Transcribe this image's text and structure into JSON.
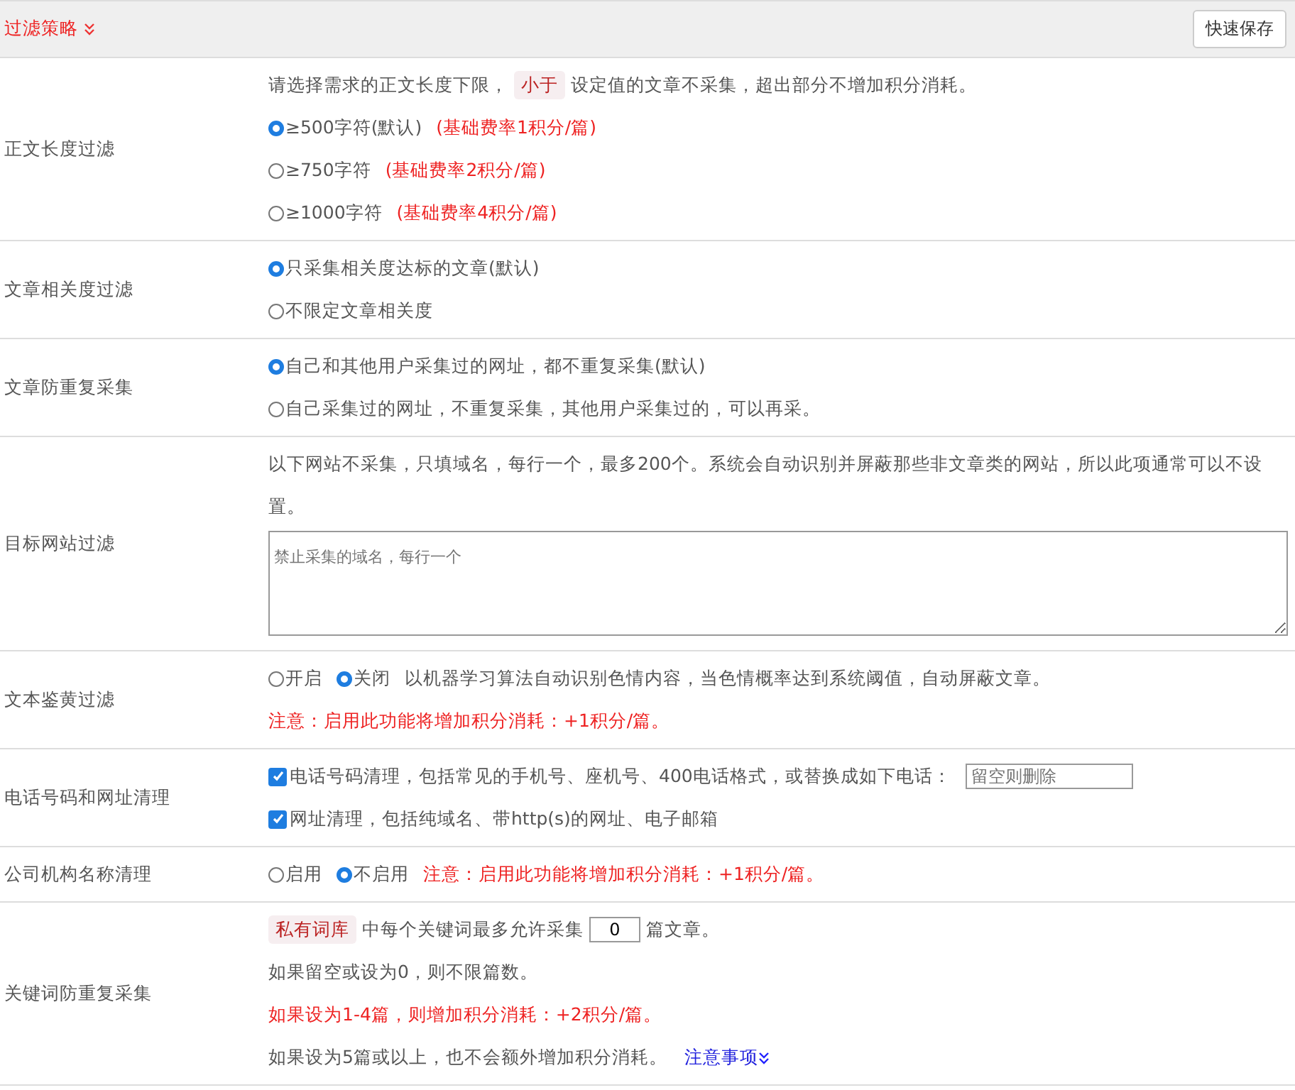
{
  "header": {
    "title": "过滤策略",
    "save_button": "快速保存"
  },
  "sections": [
    {
      "label": "正文长度过滤",
      "lines": [
        [
          {
            "kind": "text",
            "text": "请选择需求的正文长度下限，"
          },
          {
            "kind": "tag",
            "text": "小于"
          },
          {
            "kind": "text",
            "text": "设定值的文章不采集，超出部分不增加积分消耗。"
          }
        ],
        [
          {
            "kind": "radio",
            "text": "≥500字符(默认)",
            "selected": true
          },
          {
            "kind": "note",
            "text": "(基础费率1积分/篇)"
          }
        ],
        [
          {
            "kind": "radio",
            "text": "≥750字符",
            "selected": false
          },
          {
            "kind": "note",
            "text": "(基础费率2积分/篇)"
          }
        ],
        [
          {
            "kind": "radio",
            "text": "≥1000字符",
            "selected": false
          },
          {
            "kind": "note",
            "text": "(基础费率4积分/篇)"
          }
        ]
      ]
    },
    {
      "label": "文章相关度过滤",
      "lines": [
        [
          {
            "kind": "radio",
            "text": "只采集相关度达标的文章(默认)",
            "selected": true
          }
        ],
        [
          {
            "kind": "radio",
            "text": "不限定文章相关度",
            "selected": false
          }
        ]
      ]
    },
    {
      "label": "文章防重复采集",
      "lines": [
        [
          {
            "kind": "radio",
            "text": "自己和其他用户采集过的网址，都不重复采集(默认)",
            "selected": true
          }
        ],
        [
          {
            "kind": "radio",
            "text": "自己采集过的网址，不重复采集，其他用户采集过的，可以再采。",
            "selected": false
          }
        ]
      ]
    },
    {
      "label": "目标网站过滤",
      "lines": [
        [
          {
            "kind": "text",
            "text": "以下网站不采集，只填域名，每行一个，最多200个。系统会自动识别并屏蔽那些非文章类的网站，所以此项通常可以不设置。"
          }
        ],
        [
          {
            "kind": "textarea",
            "placeholder": "禁止采集的域名，每行一个"
          }
        ]
      ]
    },
    {
      "label": "文本鉴黄过滤",
      "lines": [
        [
          {
            "kind": "radio",
            "text": "开启",
            "selected": false
          },
          {
            "kind": "radio",
            "text": "关闭",
            "selected": true
          },
          {
            "kind": "text",
            "text": "以机器学习算法自动识别色情内容，当色情概率达到系统阈值，自动屏蔽文章。"
          }
        ],
        [
          {
            "kind": "note",
            "text": "注意：启用此功能将增加积分消耗：+1积分/篇。"
          }
        ]
      ]
    },
    {
      "label": "电话号码和网址清理",
      "lines": [
        [
          {
            "kind": "checkbox",
            "text": "电话号码清理，包括常见的手机号、座机号、400电话格式，或替换成如下电话：",
            "checked": true
          },
          {
            "kind": "input",
            "placeholder": "留空则删除"
          }
        ],
        [
          {
            "kind": "checkbox",
            "text": "网址清理，包括纯域名、带http(s)的网址、电子邮箱",
            "checked": true
          }
        ]
      ]
    },
    {
      "label": "公司机构名称清理",
      "lines": [
        [
          {
            "kind": "radio",
            "text": "启用",
            "selected": false
          },
          {
            "kind": "radio",
            "text": "不启用",
            "selected": true
          },
          {
            "kind": "note",
            "text": "注意：启用此功能将增加积分消耗：+1积分/篇。"
          }
        ]
      ]
    },
    {
      "label": "关键词防重复采集",
      "lines": [
        [
          {
            "kind": "tag",
            "text": "私有词库"
          },
          {
            "kind": "text",
            "text": "中每个关键词最多允许采集"
          },
          {
            "kind": "input",
            "value": "0"
          },
          {
            "kind": "text",
            "text": "篇文章。"
          }
        ],
        [
          {
            "kind": "text",
            "text": "如果留空或设为0，则不限篇数。"
          }
        ],
        [
          {
            "kind": "note",
            "text": "如果设为1-4篇，则增加积分消耗：+2积分/篇。"
          }
        ],
        [
          {
            "kind": "text",
            "text": "如果设为5篇或以上，也不会额外增加积分消耗。"
          },
          {
            "kind": "link",
            "text": "注意事项"
          }
        ]
      ]
    }
  ]
}
